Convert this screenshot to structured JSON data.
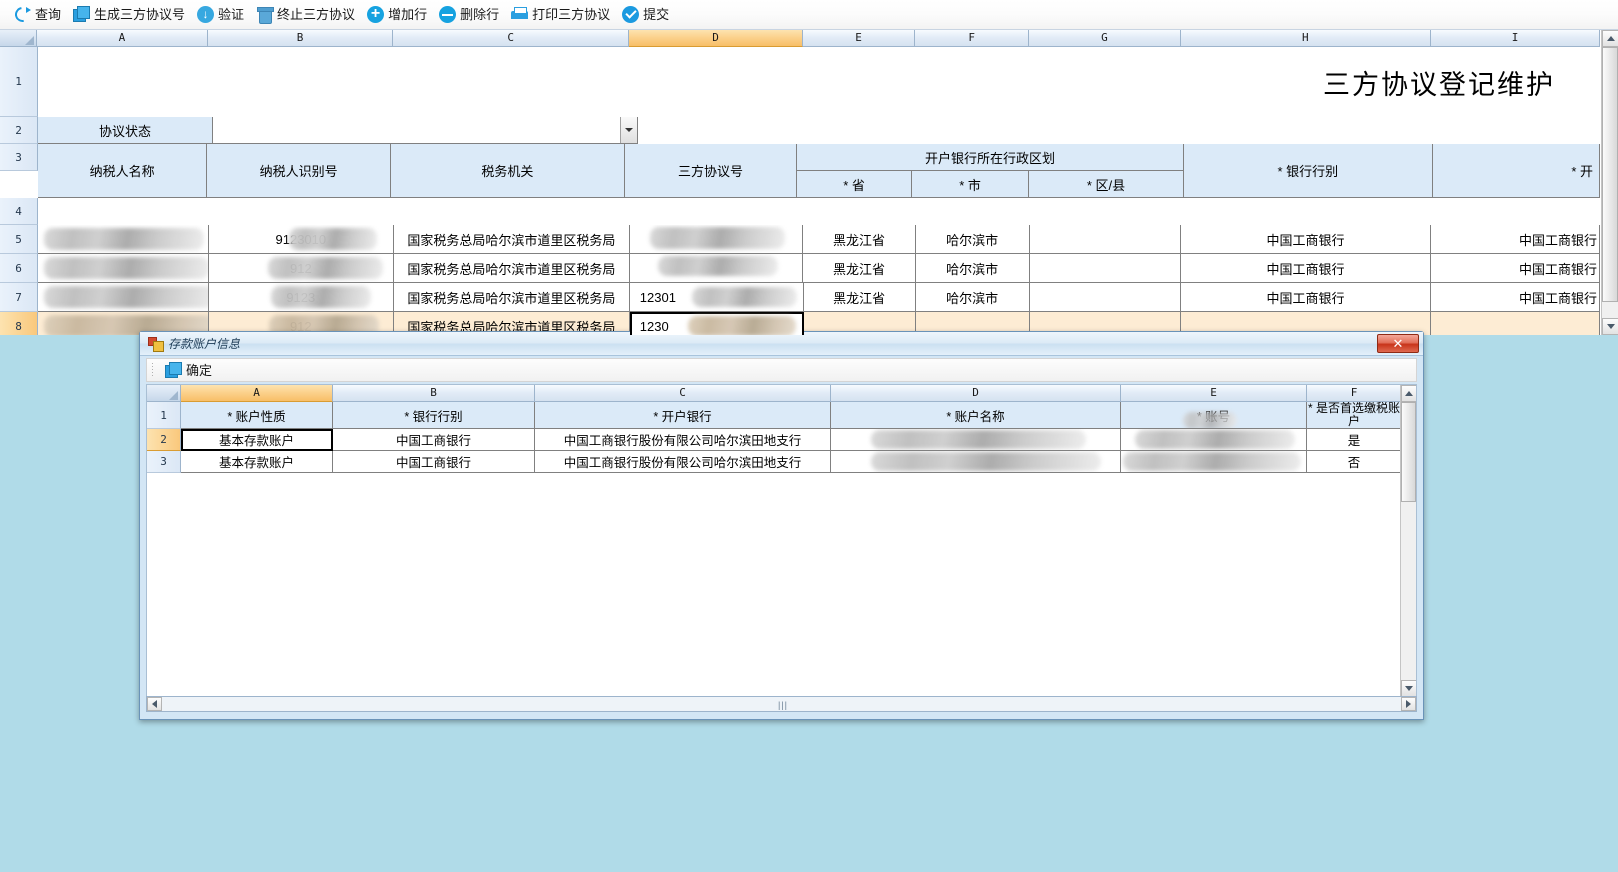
{
  "toolbar": {
    "buttons": [
      {
        "label": "查询",
        "icon": "refresh-icon"
      },
      {
        "label": "生成三方协议号",
        "icon": "copy-icon"
      },
      {
        "label": "验证",
        "icon": "download-verify-icon"
      },
      {
        "label": "终止三方协议",
        "icon": "trash-icon"
      },
      {
        "label": "增加行",
        "icon": "plus-circle-icon"
      },
      {
        "label": "删除行",
        "icon": "minus-circle-icon"
      },
      {
        "label": "打印三方协议",
        "icon": "printer-icon"
      },
      {
        "label": "提交",
        "icon": "check-circle-icon"
      }
    ]
  },
  "sheet": {
    "column_letters": [
      "A",
      "B",
      "C",
      "D",
      "E",
      "F",
      "G",
      "H",
      "I"
    ],
    "selected_column": "D",
    "row_numbers": [
      "1",
      "2",
      "3",
      "4",
      "5",
      "6",
      "7",
      "8"
    ],
    "selected_row": "8",
    "title": "三方协议登记维护",
    "status_label": "协议状态",
    "status_value": "",
    "headers": {
      "taxpayer_name": "纳税人名称",
      "taxpayer_id": "纳税人识别号",
      "tax_authority": "税务机关",
      "agreement_no": "三方协议号",
      "bank_region_group": "开户银行所在行政区划",
      "province": "* 省",
      "city": "* 市",
      "district": "* 区/县",
      "bank_type": "* 银行行别",
      "bank_open": "* 开"
    },
    "rows": [
      {
        "row": "5",
        "taxpayer_name": "",
        "taxpayer_id": "9123010",
        "tax_authority": "国家税务总局哈尔滨市道里区税务局",
        "agreement_no": "",
        "province": "黑龙江省",
        "city": "哈尔滨市",
        "district": "",
        "bank_type": "中国工商银行",
        "bank_open": "中国工商银行"
      },
      {
        "row": "6",
        "taxpayer_name": "",
        "taxpayer_id": "912",
        "tax_authority": "国家税务总局哈尔滨市道里区税务局",
        "agreement_no": "",
        "province": "黑龙江省",
        "city": "哈尔滨市",
        "district": "",
        "bank_type": "中国工商银行",
        "bank_open": "中国工商银行"
      },
      {
        "row": "7",
        "taxpayer_name": "",
        "taxpayer_id": "9123",
        "tax_authority": "国家税务总局哈尔滨市道里区税务局",
        "agreement_no": "12301",
        "province": "黑龙江省",
        "city": "哈尔滨市",
        "district": "",
        "bank_type": "中国工商银行",
        "bank_open": "中国工商银行"
      },
      {
        "row": "8",
        "taxpayer_name": "",
        "taxpayer_id": "912",
        "tax_authority": "国家税务总局哈尔滨市道里区税务局",
        "agreement_no": "1230",
        "province": "",
        "city": "",
        "district": "",
        "bank_type": "",
        "bank_open": ""
      }
    ]
  },
  "dialog": {
    "title": "存款账户信息",
    "close_label": "✕",
    "toolbar": {
      "confirm_label": "确定",
      "confirm_icon": "copy-icon"
    },
    "grid": {
      "column_letters": [
        "A",
        "B",
        "C",
        "D",
        "E",
        "F"
      ],
      "selected_column": "A",
      "row_numbers": [
        "1",
        "2",
        "3"
      ],
      "selected_row": "2",
      "headers": {
        "account_nature": "* 账户性质",
        "bank_type": "* 银行行别",
        "bank_open": "* 开户银行",
        "account_name": "* 账户名称",
        "account_no": "* 账号",
        "is_primary": "* 是否首选缴税账户"
      },
      "rows": [
        {
          "row": "2",
          "account_nature": "基本存款账户",
          "bank_type": "中国工商银行",
          "bank_open": "中国工商银行股份有限公司哈尔滨田地支行",
          "account_name": "",
          "account_no": "",
          "is_primary": "是"
        },
        {
          "row": "3",
          "account_nature": "基本存款账户",
          "bank_type": "中国工商银行",
          "bank_open": "中国工商银行股份有限公司哈尔滨田地支行",
          "account_name": "",
          "account_no": "",
          "is_primary": "否"
        }
      ]
    }
  },
  "colors": {
    "accent_blue": "#1b9ae0",
    "header_blue": "#dbeaf8",
    "selected_orange": "#fdecd4",
    "desktop_teal": "#b0dbe8"
  }
}
